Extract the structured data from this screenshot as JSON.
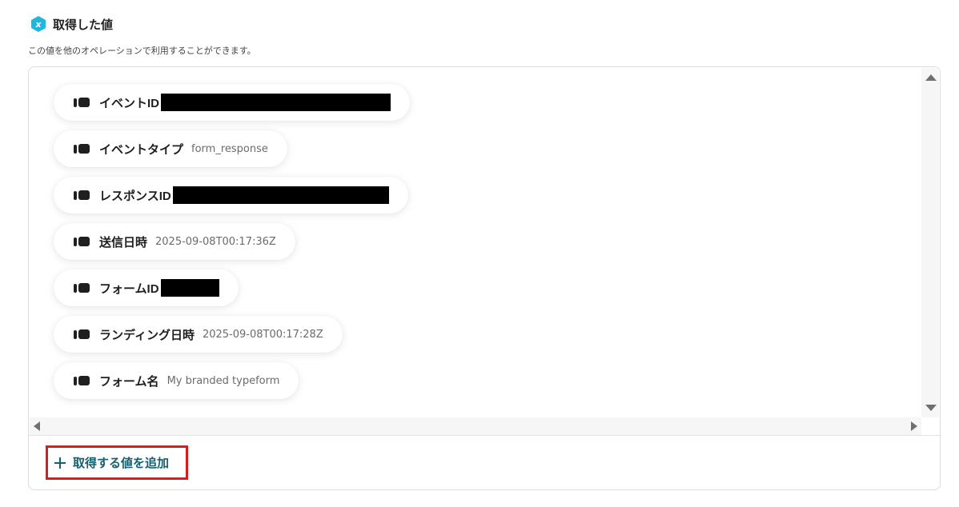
{
  "header": {
    "title": "取得した値",
    "icon": "x-variable-icon",
    "icon_color": "#1fb6e0"
  },
  "subtitle": "この値を他のオペレーションで利用することができます。",
  "fields": [
    {
      "label": "イベントID",
      "value": "",
      "redacted": true
    },
    {
      "label": "イベントタイプ",
      "value": "form_response",
      "redacted": false
    },
    {
      "label": "レスポンスID",
      "value": "",
      "redacted": true
    },
    {
      "label": "送信日時",
      "value": "2025-09-08T00:17:36Z",
      "redacted": false
    },
    {
      "label": "フォームID",
      "value": "",
      "redacted": true
    },
    {
      "label": "ランディング日時",
      "value": "2025-09-08T00:17:28Z",
      "redacted": false
    },
    {
      "label": "フォーム名",
      "value": "My branded typeform",
      "redacted": false
    }
  ],
  "add_button": {
    "label": "取得する値を追加",
    "color": "#15606e",
    "highlight_color": "#e01919"
  }
}
